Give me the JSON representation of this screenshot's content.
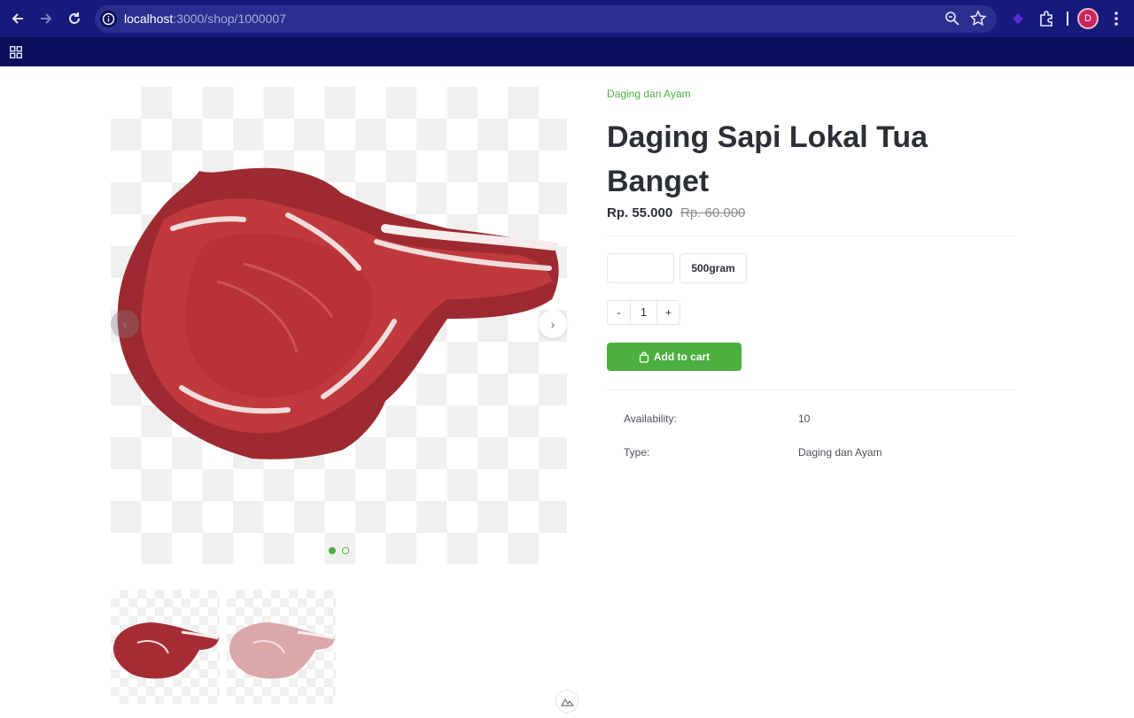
{
  "browser": {
    "url_host": "localhost",
    "url_path": ":3000/shop/1000007",
    "profile_initial": "D"
  },
  "gallery": {
    "images": [
      "meat-raw",
      "meat-pale"
    ],
    "active_index": 0,
    "prev_label": "‹",
    "next_label": "›"
  },
  "product": {
    "category": "Daging dan Ayam",
    "title": "Daging Sapi Lokal Tua Banget",
    "price": "Rp. 55.000",
    "old_price": "Rp. 60.000",
    "variants": [
      "",
      "500gram"
    ],
    "quantity": "1",
    "qty_minus": "-",
    "qty_plus": "+",
    "add_to_cart_label": "Add to cart"
  },
  "specs": [
    {
      "label": "Availability:",
      "value": "10"
    },
    {
      "label": "Type:",
      "value": "Daging dan Ayam"
    }
  ],
  "colors": {
    "accent": "#4caf3f",
    "chrome": "#161a7a",
    "text": "#2b2f36"
  }
}
